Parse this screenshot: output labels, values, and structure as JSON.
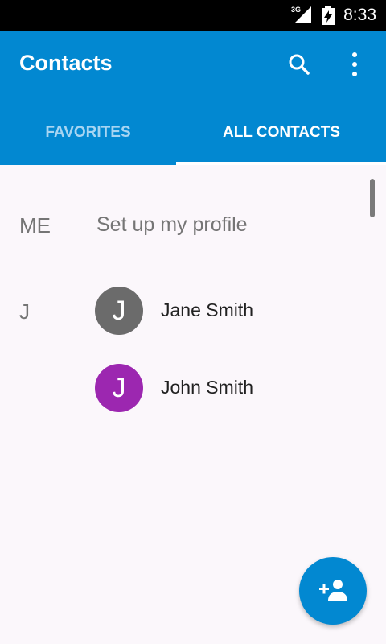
{
  "status_bar": {
    "network": "3G",
    "time": "8:33",
    "icons": [
      "signal-icon",
      "battery-charging-icon"
    ]
  },
  "app_bar": {
    "title": "Contacts",
    "icons": [
      "search-icon",
      "more-vert-icon"
    ],
    "color": "#0288d1"
  },
  "tabs": [
    {
      "label": "FAVORITES",
      "selected": false
    },
    {
      "label": "ALL CONTACTS",
      "selected": true
    }
  ],
  "me_section": {
    "header": "ME",
    "label": "Set up my profile"
  },
  "contacts": {
    "section_letter": "J",
    "items": [
      {
        "initial": "J",
        "name": "Jane Smith",
        "avatar_color": "#6b6b6b"
      },
      {
        "initial": "J",
        "name": "John Smith",
        "avatar_color": "#9c27b0"
      }
    ]
  },
  "fab": {
    "icon": "add-person-icon"
  }
}
